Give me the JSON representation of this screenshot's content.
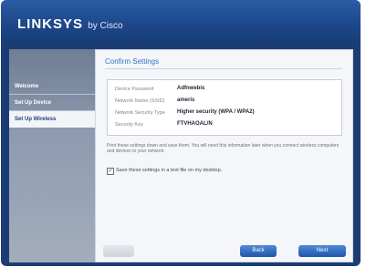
{
  "window": {
    "logo_brand": "LINKSYS",
    "logo_suffix": "by Cisco"
  },
  "sidebar": {
    "items": [
      {
        "label": "Welcome",
        "active": false
      },
      {
        "label": "Set Up Device",
        "active": false
      },
      {
        "label": "Set Up Wireless",
        "active": true
      }
    ]
  },
  "main": {
    "title": "Confirm Settings",
    "settings": [
      {
        "label": "Device Password",
        "value": "Adfnwebis"
      },
      {
        "label": "Network Name (SSID)",
        "value": "ameris"
      },
      {
        "label": "Network Security Type",
        "value": "Higher security (WPA / WPA2)"
      },
      {
        "label": "Security Key",
        "value": "FTVHAOAL/N"
      }
    ],
    "instructions": "Print these settings down and save them. You will need this information later when you connect wireless computers and devices to your network.",
    "save_checkbox_label": "Save these settings in a text file on my desktop.",
    "save_checked": true,
    "checkmark": "✓"
  },
  "buttons": {
    "back": "Back",
    "next": "Next"
  },
  "colors": {
    "header": "#1c4587",
    "title": "#2f73c6",
    "primary_button": "#1f56a8"
  }
}
